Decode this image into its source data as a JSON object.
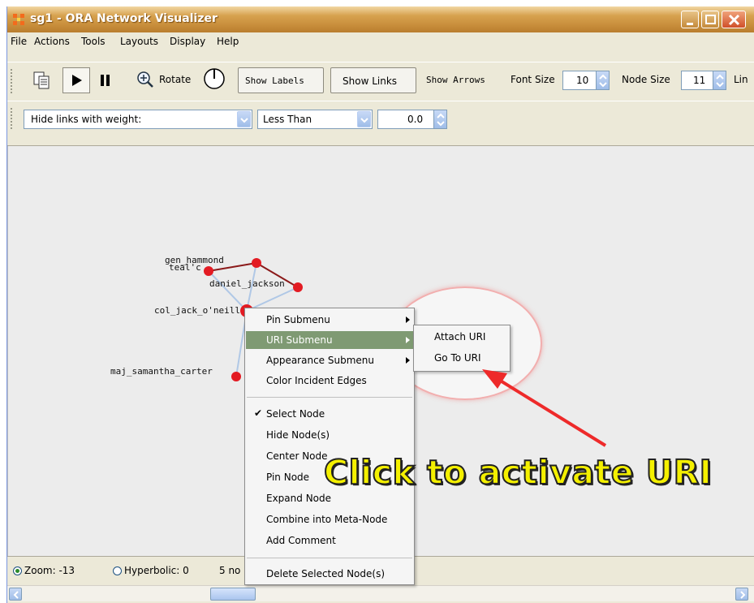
{
  "window": {
    "title": "sg1 - ORA Network Visualizer",
    "title_color": "#c98f3c"
  },
  "menubar": {
    "items": [
      "File",
      "Actions",
      "Tools",
      "Layouts",
      "Display",
      "Help"
    ]
  },
  "toolbar": {
    "rotate_label": "Rotate",
    "show_labels": "Show Labels",
    "show_links": "Show Links",
    "show_arrows": "Show Arrows",
    "font_size_label": "Font Size",
    "font_size_value": "10",
    "node_size_label": "Node Size",
    "node_size_value": "11",
    "link_label_partial": "Lin"
  },
  "filterbar": {
    "filter_select": "Hide links with weight:",
    "comparison_select": "Less Than",
    "weight_value": "0.0"
  },
  "graph": {
    "node_color": "#e31b23",
    "edge_color_dark": "#8b1a1a",
    "edge_color_light": "#b0c8e6",
    "nodes": [
      {
        "id": "gen_hammond",
        "label": "gen_hammond"
      },
      {
        "id": "teal'c",
        "label": "teal'c"
      },
      {
        "id": "daniel_jackson",
        "label": "daniel_jackson"
      },
      {
        "id": "col_jack_o'neill",
        "label": "col_jack_o'neill"
      },
      {
        "id": "maj_samantha_carter",
        "label": "maj_samantha_carter"
      }
    ]
  },
  "context_menu": {
    "pin_submenu": "Pin Submenu",
    "uri_submenu": "URI Submenu",
    "appearance_submenu": "Appearance Submenu",
    "color_incident_edges": "Color Incident Edges",
    "select_node": "Select Node",
    "hide_nodes": "Hide Node(s)",
    "center_node": "Center Node",
    "pin_node": "Pin Node",
    "expand_node": "Expand Node",
    "combine_meta": "Combine into Meta-Node",
    "add_comment": "Add Comment",
    "delete_selected": "Delete Selected Node(s)",
    "highlight_color": "#7f9a73"
  },
  "uri_submenu": {
    "attach_uri": "Attach URI",
    "go_to_uri": "Go To URI"
  },
  "status": {
    "zoom_label": "Zoom: -13",
    "hyperbolic_label": "Hyperbolic: 0",
    "node_count_partial": "5 no"
  },
  "annotation": {
    "callout_text": "Click to activate URI",
    "callout_color": "#f4f000",
    "arrow_color": "#ee2a2a"
  },
  "icons": [
    "app-icon",
    "minimize-icon",
    "maximize-icon",
    "close-icon",
    "copy-icon",
    "play-icon",
    "pause-icon",
    "zoom-in-icon",
    "rotate-dial-icon",
    "spinner-up-icon",
    "chevron-down-icon",
    "scroll-left-icon",
    "scroll-right-icon"
  ]
}
